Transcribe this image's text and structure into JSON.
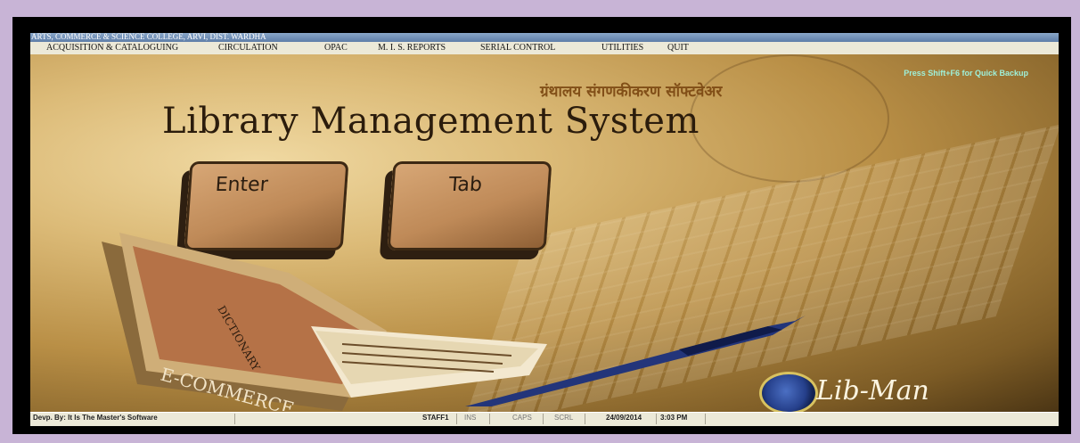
{
  "window": {
    "title": "ARTS, COMMERCE & SCIENCE COLLEGE, ARVI, DIST. WARDHA"
  },
  "menu": {
    "items": [
      "ACQUISITION & CATALOGUING",
      "CIRCULATION",
      "OPAC",
      "M. I. S.  REPORTS",
      "SERIAL CONTROL",
      "UTILITIES",
      "QUIT"
    ]
  },
  "main": {
    "backup_hint": "Press Shift+F6 for Quick Backup",
    "marathi_title": "ग्रंथालय संगणकीकरण सॉफ्टवेअर",
    "app_title": "Library Management System",
    "enter_key": "Enter",
    "tab_key": "Tab",
    "logo_text": "Lib-Man"
  },
  "status": {
    "developer": "Devp. By: It Is The Master's Software",
    "user": "STAFF1",
    "ins": "INS",
    "caps": "CAPS",
    "scrl": "SCRL",
    "date": "24/09/2014",
    "time": "3:03 PM"
  },
  "colors": {
    "backup_hint": "#9ff0d9",
    "title_bar": "#6f8fb8",
    "menu_bar": "#ece9d8",
    "background_gold": "#c9a15d"
  }
}
